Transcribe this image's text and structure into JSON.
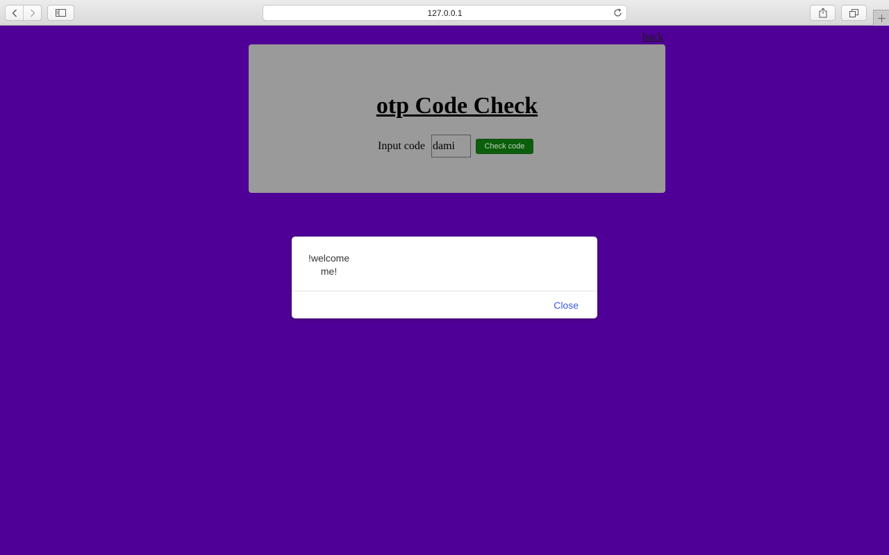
{
  "browser": {
    "url": "127.0.0.1",
    "icons": {
      "back": "chevron-left-icon",
      "forward": "chevron-right-icon",
      "sidebar": "sidebar-icon",
      "reload": "reload-icon",
      "share": "share-icon",
      "tabs": "tabs-overview-icon",
      "new_tab": "plus-icon"
    }
  },
  "page": {
    "background": "#4f0096",
    "back_link": "back",
    "title": "otp Code Check",
    "input_label": "Input code",
    "input_value": "dami",
    "check_button": "Check code",
    "check_button_color": "#0b5e0b"
  },
  "dialog": {
    "message_line1": "!welcome",
    "message_line2": "me!",
    "close_label": "Close"
  }
}
